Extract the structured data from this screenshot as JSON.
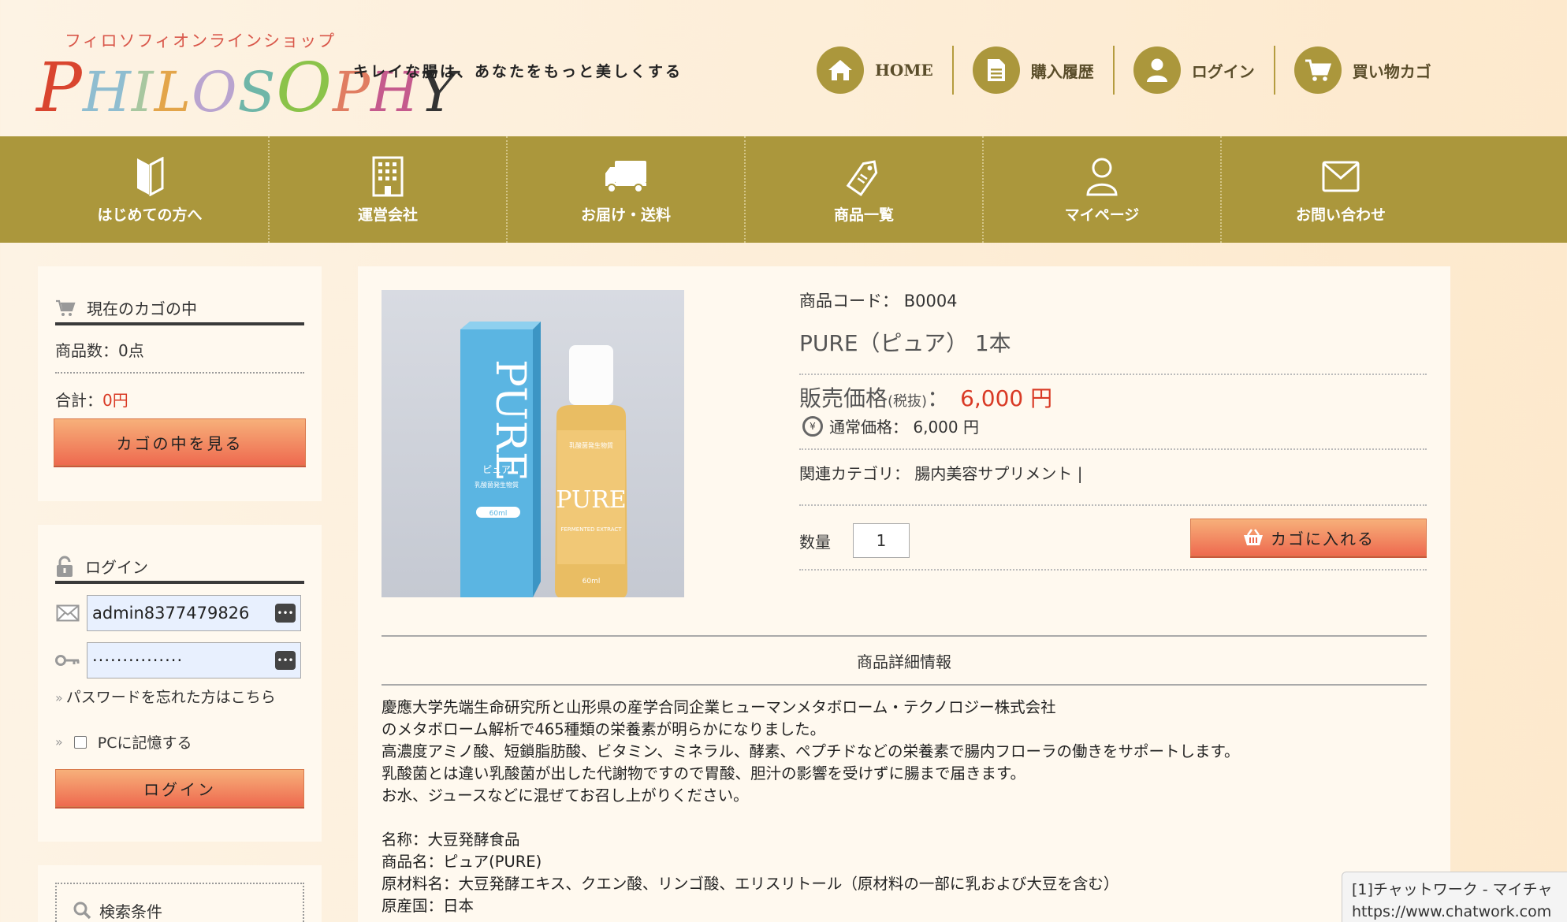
{
  "header": {
    "logo_sub": "フィロソフィオンラインショップ",
    "logo_letters": [
      "P",
      "H",
      "I",
      "L",
      "O",
      "S",
      "O",
      "P",
      "H",
      "Y"
    ],
    "tagline": "キレイな腸は、あなたをもっと美しくする",
    "nav": [
      {
        "label": "HOME",
        "icon": "home-icon"
      },
      {
        "label": "購入履歴",
        "icon": "document-icon"
      },
      {
        "label": "ログイン",
        "icon": "user-icon"
      },
      {
        "label": "買い物カゴ",
        "icon": "cart-icon"
      }
    ]
  },
  "main_nav": [
    {
      "label": "はじめての方へ",
      "icon": "beginner-mark-icon"
    },
    {
      "label": "運営会社",
      "icon": "building-icon"
    },
    {
      "label": "お届け・送料",
      "icon": "truck-icon"
    },
    {
      "label": "商品一覧",
      "icon": "tag-icon"
    },
    {
      "label": "マイページ",
      "icon": "person-icon"
    },
    {
      "label": "お問い合わせ",
      "icon": "mail-icon"
    }
  ],
  "sidebar": {
    "cart": {
      "title": "現在のカゴの中",
      "count_label": "商品数：",
      "count_value": "0点",
      "total_label": "合計：",
      "total_value": "0円",
      "view_button": "カゴの中を見る"
    },
    "login": {
      "title": "ログイン",
      "email_value": "admin8377479826",
      "password_value": "···············",
      "forgot_link": "パスワードを忘れた方はこちら",
      "remember_label": "PCに記憶する",
      "login_button": "ログイン"
    },
    "search": {
      "title": "検索条件"
    }
  },
  "product": {
    "code_label": "商品コード：",
    "code_value": "B0004",
    "name": "PURE（ピュア） 1本",
    "price_label": "販売価格",
    "tax_note": "(税抜)",
    "price_sep": "：",
    "price_value": "6,000 円",
    "normal_price_label": "通常価格：",
    "normal_price_value": "6,000 円",
    "category_label": "関連カテゴリ：",
    "category_value": "腸内美容サプリメント |",
    "qty_label": "数量",
    "qty_value": "1",
    "add_button": "カゴに入れる",
    "image": {
      "box_text": "PURE",
      "box_kana": "ピュア",
      "box_sub": "乳酸菌発生物質",
      "box_volume": "60ml",
      "bottle_top": "乳酸菌発生物質",
      "bottle_text": "PURE",
      "bottle_sub": "FERMENTED EXTRACT",
      "bottle_volume": "60ml"
    }
  },
  "details": {
    "title": "商品詳細情報",
    "lines": [
      "慶應大学先端生命研究所と山形県の産学合同企業ヒューマンメタボローム・テクノロジー株式会社",
      "のメタボローム解析で465種類の栄養素が明らかになりました。",
      "高濃度アミノ酸、短鎖脂肪酸、ビタミン、ミネラル、酵素、ペプチドなどの栄養素で腸内フローラの働きをサポートします。",
      "乳酸菌とは違い乳酸菌が出した代謝物ですので胃酸、胆汁の影響を受けずに腸まで届きます。",
      "お水、ジュースなどに混ぜてお召し上がりください。"
    ],
    "specs": [
      "名称：大豆発酵食品",
      "商品名：ピュア(PURE)",
      "原材料名：大豆発酵エキス、クエン酸、リンゴ酸、エリスリトール（原材料の一部に乳および大豆を含む）",
      "原産国：日本"
    ]
  },
  "popup": {
    "title": "[1]チャットワーク - マイチャ",
    "url": "https://www.chatwork.com"
  },
  "colors": {
    "olive": "#ab973c",
    "price_red": "#d93a25",
    "button_top": "#f7b07a",
    "button_bottom": "#ee6a4f"
  }
}
